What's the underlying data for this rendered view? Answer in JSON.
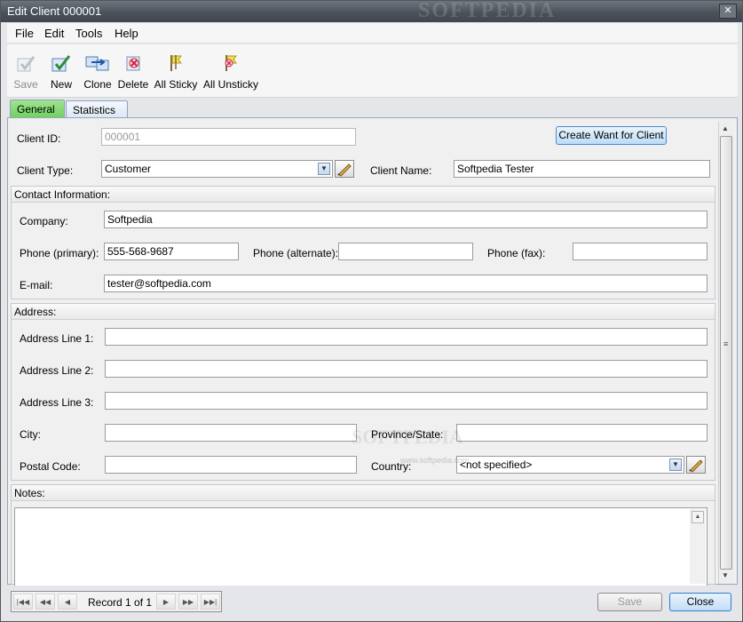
{
  "window": {
    "title": "Edit Client 000001",
    "watermark": "SOFTPEDIA"
  },
  "menu": [
    "File",
    "Edit",
    "Tools",
    "Help"
  ],
  "toolbar": [
    {
      "label": "Save",
      "icon": "save-icon",
      "enabled": false
    },
    {
      "label": "New",
      "icon": "new-check-icon",
      "enabled": true
    },
    {
      "label": "Clone",
      "icon": "clone-icon",
      "enabled": true
    },
    {
      "label": "Delete",
      "icon": "delete-icon",
      "enabled": true
    },
    {
      "label": "All Sticky",
      "icon": "sticky-flag-icon",
      "enabled": true
    },
    {
      "label": "All Unsticky",
      "icon": "unsticky-flag-icon",
      "enabled": true
    }
  ],
  "tabs": {
    "general": "General",
    "statistics": "Statistics"
  },
  "general": {
    "client_id_label": "Client ID:",
    "client_id": "000001",
    "create_want_button": "Create Want for Client",
    "client_type_label": "Client Type:",
    "client_type": "Customer",
    "client_name_label": "Client Name:",
    "client_name": "Softpedia Tester"
  },
  "contact": {
    "heading": "Contact Information:",
    "company_label": "Company:",
    "company": "Softpedia",
    "phone_primary_label": "Phone (primary):",
    "phone_primary": "555-568-9687",
    "phone_alternate_label": "Phone (alternate):",
    "phone_alternate": "",
    "phone_fax_label": "Phone (fax):",
    "phone_fax": "",
    "email_label": "E-mail:",
    "email": "tester@softpedia.com"
  },
  "address": {
    "heading": "Address:",
    "line1_label": "Address Line 1:",
    "line1": "",
    "line2_label": "Address Line 2:",
    "line2": "",
    "line3_label": "Address Line 3:",
    "line3": "",
    "city_label": "City:",
    "city": "",
    "province_label": "Province/State:",
    "province": "",
    "postal_label": "Postal Code:",
    "postal": "",
    "country_label": "Country:",
    "country": "<not specified>"
  },
  "notes": {
    "heading": "Notes:",
    "text": ""
  },
  "footer": {
    "record": "Record 1 of 1",
    "save": "Save",
    "close": "Close",
    "watermark_url": "www.softpedia.com"
  }
}
